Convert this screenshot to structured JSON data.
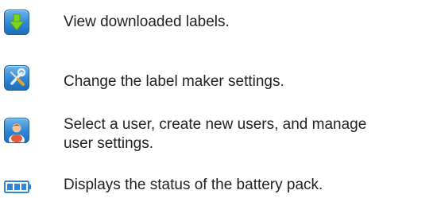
{
  "items": [
    {
      "icon": "download-arrow-icon",
      "lines": [
        "View downloaded labels."
      ]
    },
    {
      "icon": "tools-icon",
      "lines": [
        "Change the label maker settings."
      ]
    },
    {
      "icon": "user-icon",
      "lines": [
        "Select a user, create new users, and manage",
        "user settings."
      ]
    },
    {
      "icon": "battery-icon",
      "lines": [
        "Displays the status of the battery pack."
      ]
    }
  ],
  "colors": {
    "tile": "#2f86d6",
    "arrow": "#7ed321",
    "battery": "#2f86d6",
    "text": "#222222"
  }
}
